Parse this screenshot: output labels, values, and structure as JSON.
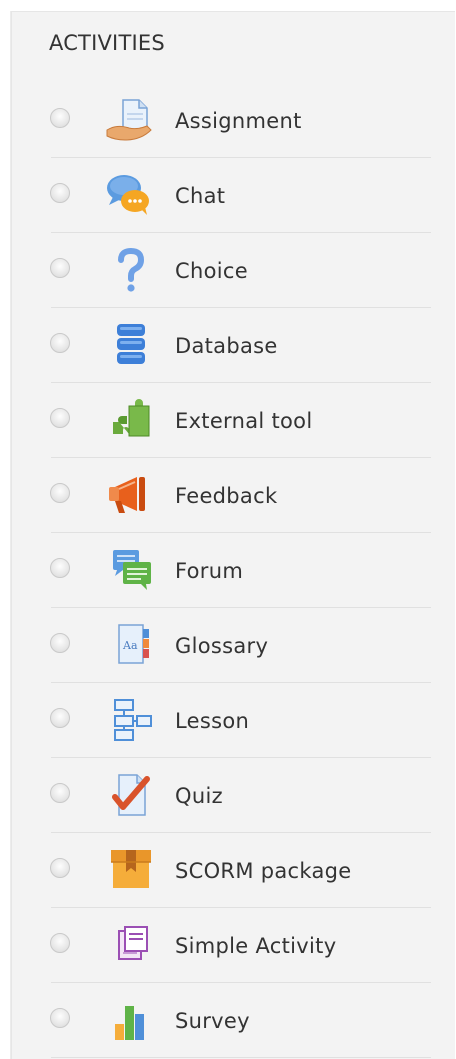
{
  "heading": "ACTIVITIES",
  "items": [
    {
      "label": "Assignment",
      "icon": "assignment-icon"
    },
    {
      "label": "Chat",
      "icon": "chat-icon"
    },
    {
      "label": "Choice",
      "icon": "choice-icon"
    },
    {
      "label": "Database",
      "icon": "database-icon"
    },
    {
      "label": "External tool",
      "icon": "external-tool-icon"
    },
    {
      "label": "Feedback",
      "icon": "feedback-icon"
    },
    {
      "label": "Forum",
      "icon": "forum-icon"
    },
    {
      "label": "Glossary",
      "icon": "glossary-icon"
    },
    {
      "label": "Lesson",
      "icon": "lesson-icon"
    },
    {
      "label": "Quiz",
      "icon": "quiz-icon"
    },
    {
      "label": "SCORM package",
      "icon": "scorm-package-icon"
    },
    {
      "label": "Simple Activity",
      "icon": "simple-activity-icon"
    },
    {
      "label": "Survey",
      "icon": "survey-icon"
    }
  ],
  "glossary_icon_text": "Aa"
}
